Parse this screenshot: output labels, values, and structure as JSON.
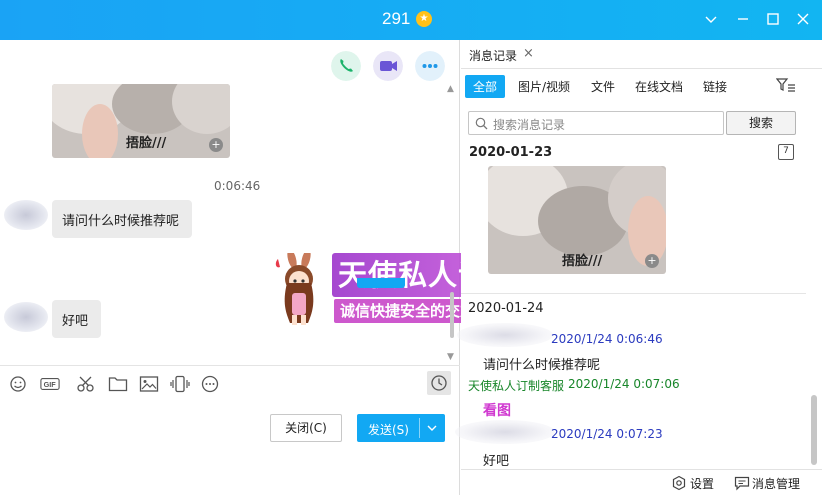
{
  "window": {
    "title": "291",
    "star_icon": "star-badge-icon",
    "controls": [
      "chevron-down-icon",
      "minimize-icon",
      "maximize-icon",
      "close-icon"
    ]
  },
  "chat": {
    "image_caption": "捂脸///",
    "time_divider": "0:06:46",
    "messages": [
      {
        "text": "请问什么时候推荐呢"
      },
      {
        "text": "好吧"
      }
    ],
    "toolbar_icons": [
      "emoji-icon",
      "gif-icon",
      "scissors-icon",
      "folder-icon",
      "image-icon",
      "shake-icon",
      "more-icon",
      "history-clock-icon"
    ],
    "close_button": "关闭(C)",
    "send_button": "发送(S)"
  },
  "watermark": {
    "title": "天使私人订制",
    "subtitle": "诚信快捷安全的交友平台"
  },
  "history": {
    "tab_label": "消息记录",
    "filters": [
      "全部",
      "图片/视频",
      "文件",
      "在线文档",
      "链接"
    ],
    "active_filter": 0,
    "search_placeholder": "搜索消息记录",
    "search_button": "搜索",
    "date1": "2020-01-23",
    "image_caption": "捂脸///",
    "date2": "2020-01-24",
    "entries": [
      {
        "time": "2020/1/24 0:06:46",
        "text": "请问什么时候推荐呢"
      },
      {
        "sender": "天使私人订制客服",
        "time": "2020/1/24 0:07:06",
        "text": "看图"
      },
      {
        "time": "2020/1/24 0:07:23",
        "text": "好吧"
      }
    ],
    "calendar_day": "7",
    "footer": {
      "settings": "设置",
      "manage": "消息管理"
    }
  },
  "colors": {
    "accent": "#12a8f3",
    "sender_blue": "#2b3bbf",
    "service_green": "#18862a",
    "pink": "#d03ad0"
  }
}
